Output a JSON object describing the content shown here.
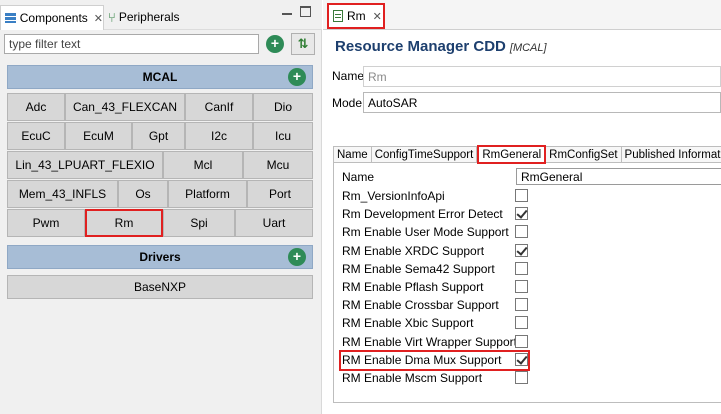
{
  "left": {
    "tabs": {
      "components": "Components",
      "peripherals": "Peripherals"
    },
    "filter_placeholder": "type filter text",
    "mcal": {
      "title": "MCAL",
      "rows": [
        [
          "Adc",
          "Can_43_FLEXCAN",
          "CanIf",
          "Dio"
        ],
        [
          "EcuC",
          "EcuM",
          "Gpt",
          "I2c",
          "Icu"
        ],
        [
          "Lin_43_LPUART_FLEXIO",
          "Mcl",
          "Mcu"
        ],
        [
          "Mem_43_INFLS",
          "Os",
          "Platform",
          "Port"
        ],
        [
          "Pwm",
          "Rm",
          "Spi",
          "Uart"
        ]
      ],
      "selected": "Rm"
    },
    "drivers": {
      "title": "Drivers",
      "items": [
        "BaseNXP"
      ]
    }
  },
  "editor": {
    "tab_label": "Rm",
    "title": "Resource Manager CDD",
    "subtitle": "[MCAL]",
    "name_label": "Name",
    "name_value": "Rm",
    "mode_label": "Mode",
    "mode_value": "AutoSAR",
    "inner_tabs": [
      "Name",
      "ConfigTimeSupport",
      "RmGeneral",
      "RmConfigSet",
      "Published Information"
    ],
    "active_inner_tab": "RmGeneral",
    "props": {
      "name_label": "Name",
      "name_value": "RmGeneral",
      "rows": [
        {
          "label": "Rm_VersionInfoApi",
          "checked": false
        },
        {
          "label": "Rm Development Error Detect",
          "checked": true
        },
        {
          "label": "Rm Enable User Mode Support",
          "checked": false
        },
        {
          "label": "RM Enable XRDC Support",
          "checked": true
        },
        {
          "label": "RM Enable Sema42 Support",
          "checked": false
        },
        {
          "label": "RM Enable Pflash Support",
          "checked": false
        },
        {
          "label": "RM Enable Crossbar Support",
          "checked": false
        },
        {
          "label": "RM Enable Xbic Support",
          "checked": false
        },
        {
          "label": "RM Enable Virt Wrapper Support",
          "checked": false
        },
        {
          "label": "RM Enable Dma Mux Support",
          "checked": true
        },
        {
          "label": "RM Enable Mscm Support",
          "checked": false
        }
      ]
    }
  },
  "colors": {
    "highlight": "#e02020",
    "group_header": "#a7bdd6",
    "add_button": "#2e8b57",
    "title": "#1d3f6e"
  }
}
